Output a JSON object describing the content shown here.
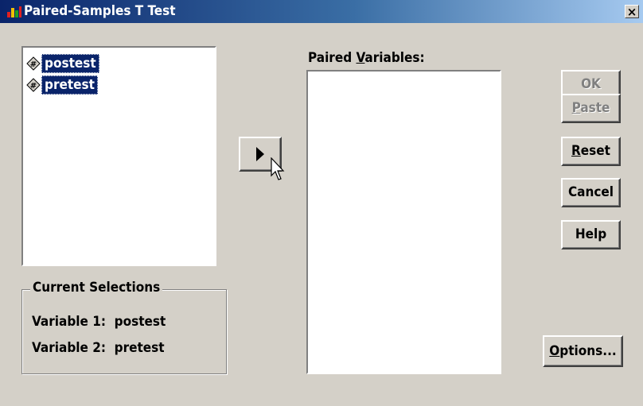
{
  "window": {
    "title": "Paired-Samples T Test",
    "close_glyph": "×"
  },
  "source_list": {
    "items": [
      {
        "label": "postest"
      },
      {
        "label": "pretest"
      }
    ]
  },
  "paired": {
    "label_prefix": "Paired ",
    "label_mnemonic": "V",
    "label_suffix": "ariables:"
  },
  "buttons": {
    "ok": "OK",
    "paste_mnemonic": "P",
    "paste_rest": "aste",
    "reset_mnemonic": "R",
    "reset_rest": "eset",
    "cancel": "Cancel",
    "help": "Help",
    "options_mnemonic": "O",
    "options_rest": "ptions..."
  },
  "current_selections": {
    "title": "Current Selections",
    "var1_label": "Variable 1:",
    "var1_value": "postest",
    "var2_label": "Variable 2:",
    "var2_value": "pretest"
  },
  "icons": {
    "variable": "scale-variable-icon",
    "arrow": "move-right-arrow-icon",
    "cursor": "mouse-pointer-icon"
  },
  "colors": {
    "selection": "#0a246a",
    "dialog_bg": "#d4d0c8",
    "title_start": "#0a246a",
    "title_end": "#a6caf0"
  }
}
